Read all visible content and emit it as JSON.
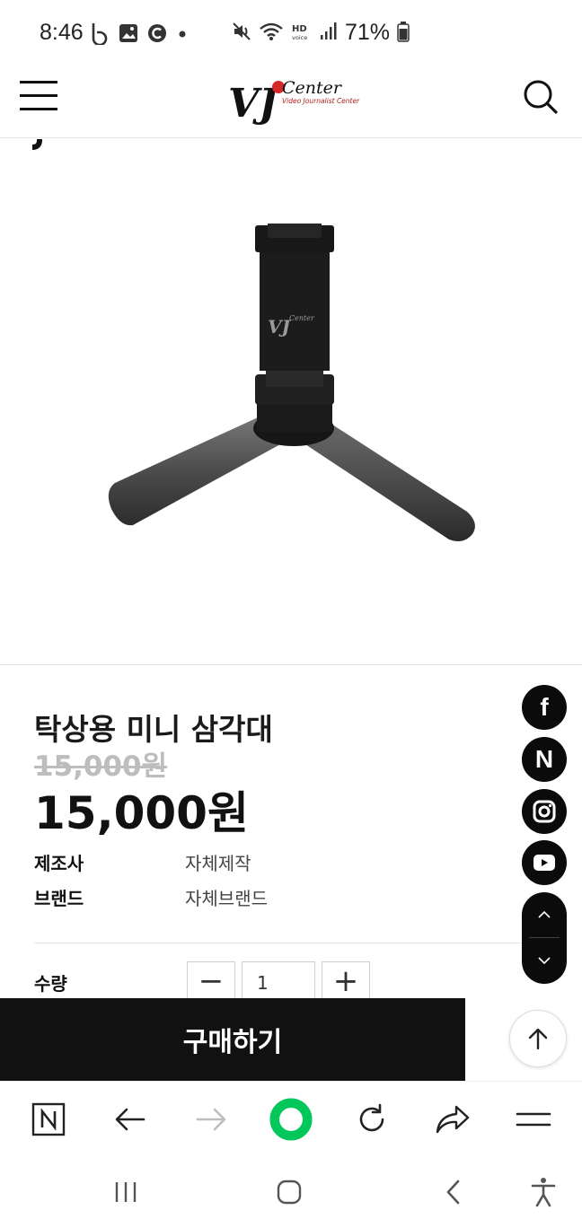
{
  "status_bar": {
    "time": "8:46",
    "battery_percent": "71%"
  },
  "header": {
    "logo": {
      "brand": "VJ",
      "script": "Center",
      "tagline": "Video Journalist Center"
    }
  },
  "product": {
    "title": "탁상용 미니 삼각대",
    "original_price": "15,000원",
    "sale_price": "15,000원",
    "specs": [
      {
        "label": "제조사",
        "value": "자체제작"
      },
      {
        "label": "브랜드",
        "value": "자체브랜드"
      }
    ],
    "quantity": {
      "label": "수량",
      "value": "1",
      "minus": "−",
      "plus": "+"
    }
  },
  "social": {
    "facebook_glyph": "f",
    "naver_glyph": "N"
  },
  "actions": {
    "buy_label": "구매하기"
  },
  "colors": {
    "dark": "#111111",
    "browser_accent": "#03c75a",
    "logo_red": "#d62828"
  },
  "icons": {
    "status": [
      "b-app-icon",
      "gallery-icon",
      "c-app-icon",
      "dot-icon",
      "mute-icon",
      "wifi-icon",
      "hd-voice-icon",
      "signal-icon",
      "battery-icon"
    ],
    "browser": [
      "naver-home-icon",
      "back-arrow-icon",
      "forward-arrow-icon",
      "green-ring-icon",
      "refresh-icon",
      "share-icon",
      "browser-menu-icon"
    ],
    "nav": [
      "recent-apps-icon",
      "home-icon",
      "back-icon",
      "accessibility-icon"
    ]
  }
}
